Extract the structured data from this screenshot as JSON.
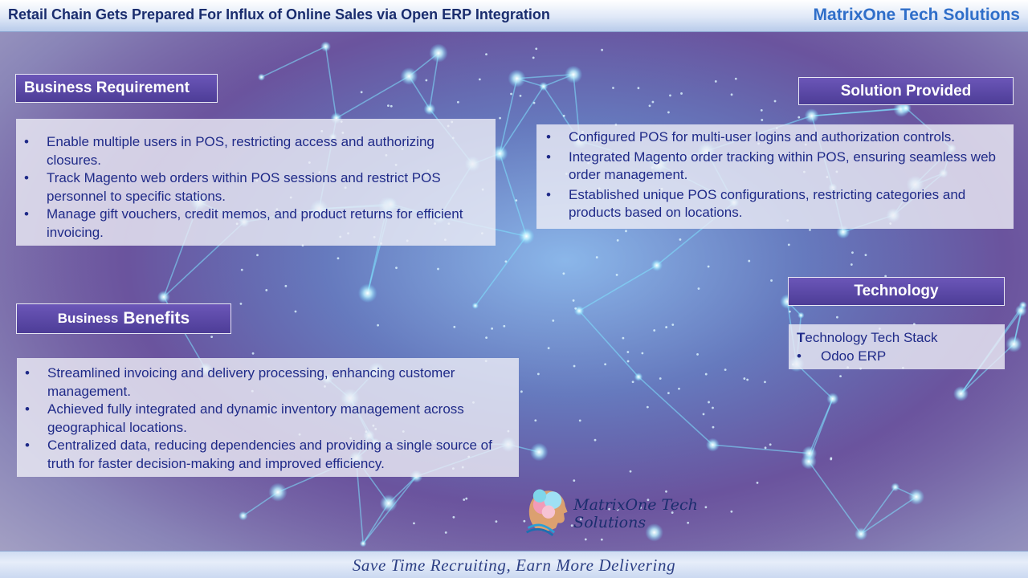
{
  "header": {
    "title": "Retail Chain Gets Prepared For Influx of Online Sales via Open ERP Integration",
    "company": "MatrixOne Tech Solutions"
  },
  "business_requirement": {
    "heading": "Business Requirement",
    "items": [
      "Enable multiple users in POS, restricting access and authorizing closures.",
      "Track Magento web orders within POS sessions and restrict POS personnel to specific stations.",
      "Manage gift vouchers, credit memos, and product returns for efficient invoicing."
    ]
  },
  "solution_provided": {
    "heading": "Solution Provided",
    "items": [
      "Configured POS for multi-user logins and authorization controls.",
      "Integrated Magento order tracking within POS, ensuring seamless web order management.",
      "Established unique POS configurations, restricting categories and products based on locations."
    ]
  },
  "technology": {
    "heading": "Technology",
    "stack_title_first": "T",
    "stack_title_rest": "echnology Tech Stack",
    "items": [
      "Odoo ERP"
    ]
  },
  "business_benefits": {
    "heading_small": "Business",
    "heading_big": "Benefits",
    "items": [
      "Streamlined invoicing and delivery processing, enhancing customer management.",
      "Achieved fully integrated and dynamic inventory management across geographical locations.",
      "Centralized data, reducing dependencies and providing a single source of truth for faster decision-making and improved efficiency."
    ]
  },
  "logo": {
    "text": "MatrixOne Tech Solutions",
    "icon": "brain-head-icon"
  },
  "footer": {
    "tagline": "Save Time Recruiting, Earn More Delivering"
  },
  "bullet": "•"
}
